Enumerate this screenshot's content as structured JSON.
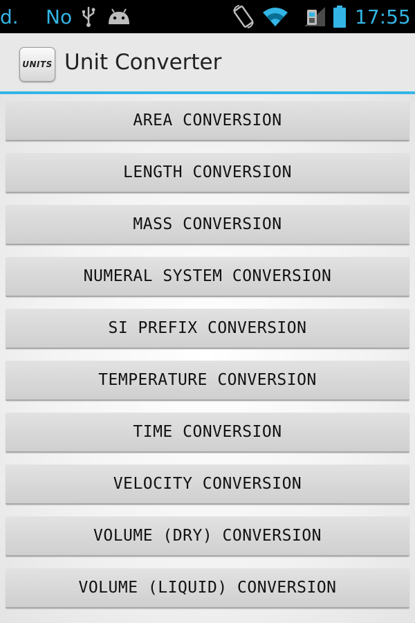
{
  "status_bar": {
    "left_text_1": "d.",
    "left_text_2": "No",
    "time": "17:55",
    "icons": [
      "usb-icon",
      "android-icon",
      "rotate-icon",
      "wifi-icon",
      "sim-icon",
      "battery-icon"
    ],
    "accent_color": "#33b5e5"
  },
  "action_bar": {
    "app_icon_text": "UNITS",
    "title": "Unit Converter",
    "accent_color": "#33b5e5"
  },
  "buttons": [
    {
      "label": "AREA CONVERSION"
    },
    {
      "label": "LENGTH CONVERSION"
    },
    {
      "label": "MASS CONVERSION"
    },
    {
      "label": "NUMERAL SYSTEM CONVERSION"
    },
    {
      "label": "SI PREFIX CONVERSION"
    },
    {
      "label": "TEMPERATURE CONVERSION"
    },
    {
      "label": "TIME CONVERSION"
    },
    {
      "label": "VELOCITY CONVERSION"
    },
    {
      "label": "VOLUME (DRY) CONVERSION"
    },
    {
      "label": "VOLUME (LIQUID) CONVERSION"
    }
  ]
}
